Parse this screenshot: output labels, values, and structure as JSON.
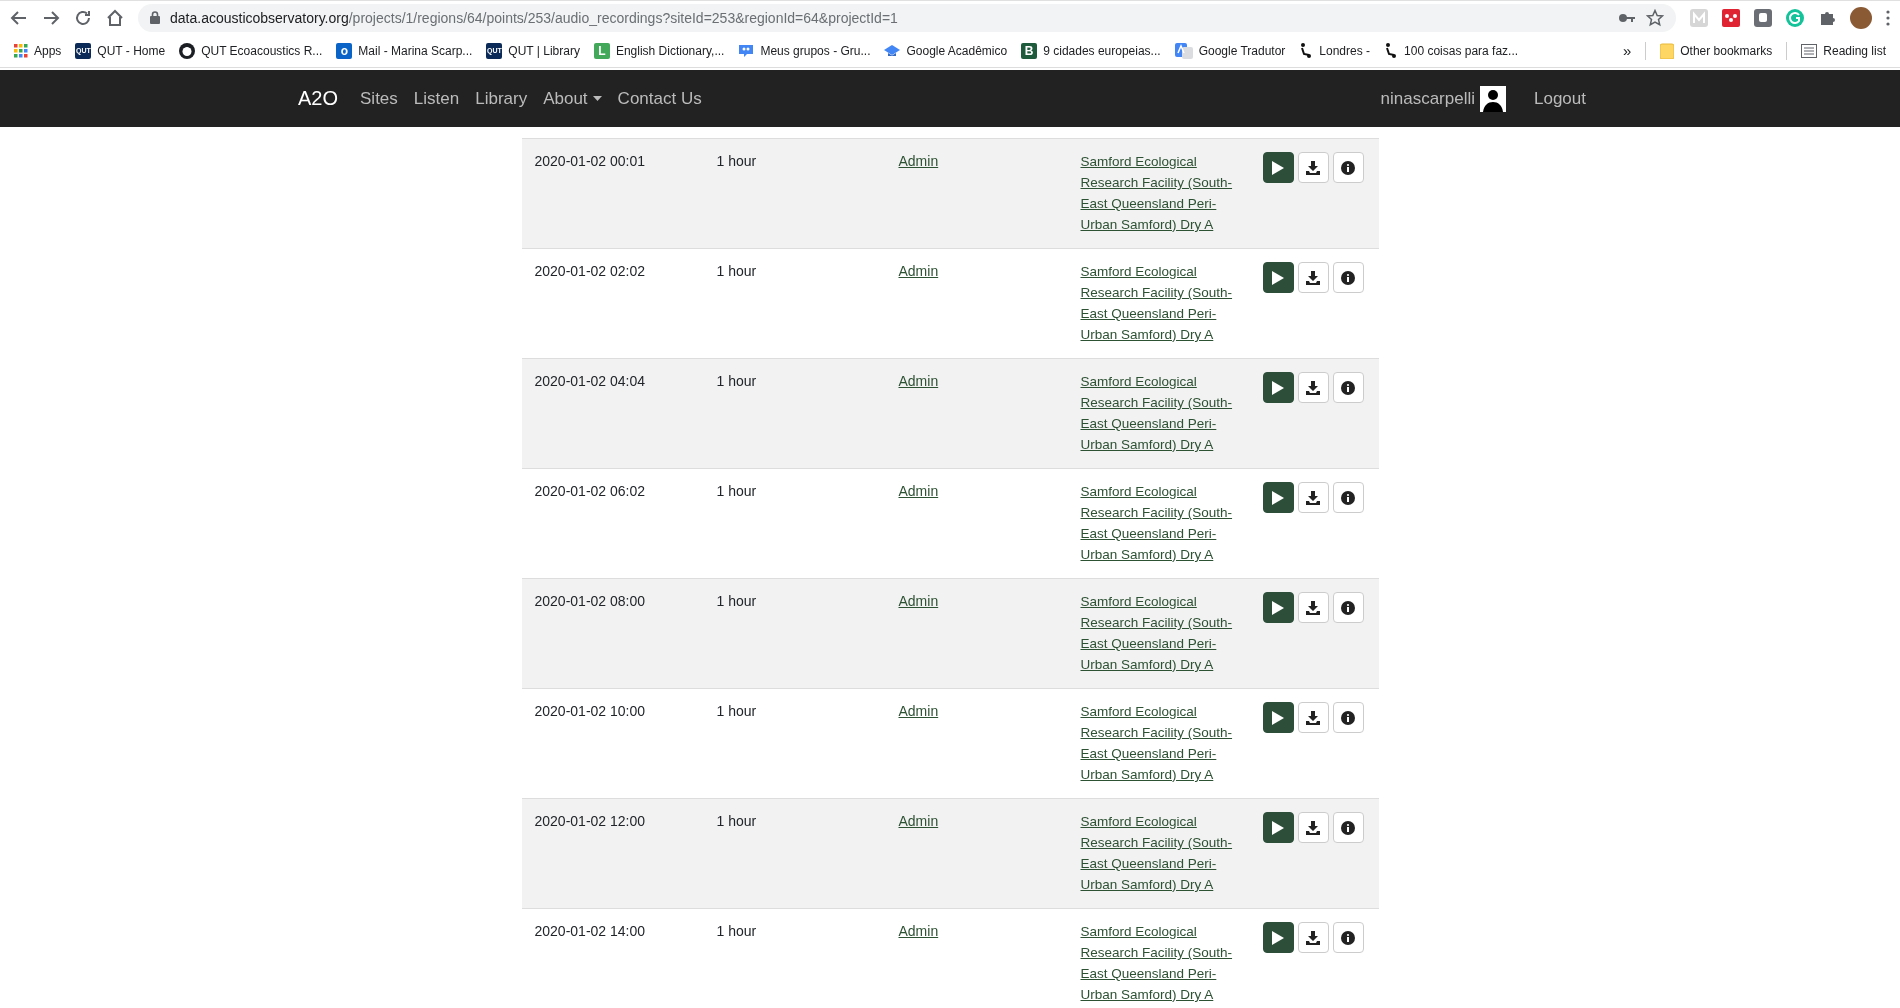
{
  "browser": {
    "url_host": "data.acousticobservatory.org",
    "url_rest": "/projects/1/regions/64/points/253/audio_recordings?siteId=253&regionId=64&projectId=1",
    "bookmarks": [
      {
        "label": "Apps",
        "icon": {
          "kind": "apps"
        }
      },
      {
        "label": "QUT - Home",
        "icon": {
          "kind": "badge",
          "badge": "QUT",
          "color": "#0b2a57"
        }
      },
      {
        "label": "QUT Ecoacoustics R...",
        "icon": {
          "kind": "github"
        }
      },
      {
        "label": "Mail - Marina Scarp...",
        "icon": {
          "kind": "badge",
          "badge": "o",
          "color": "#0a64c8"
        }
      },
      {
        "label": "QUT | Library",
        "icon": {
          "kind": "badge",
          "badge": "QUT",
          "color": "#0b2a57"
        }
      },
      {
        "label": "English Dictionary,...",
        "icon": {
          "kind": "badge",
          "badge": "L",
          "color": "#43a85a"
        }
      },
      {
        "label": "Meus grupos - Gru...",
        "icon": {
          "kind": "groups"
        }
      },
      {
        "label": "Google Acadêmico",
        "icon": {
          "kind": "cap"
        }
      },
      {
        "label": "9 cidades europeias...",
        "icon": {
          "kind": "badge",
          "badge": "B",
          "color": "#1e5b3c"
        }
      },
      {
        "label": "Google Tradutor",
        "icon": {
          "kind": "translate"
        }
      },
      {
        "label": "Londres -",
        "icon": {
          "kind": "walker"
        }
      },
      {
        "label": "100 coisas para faz...",
        "icon": {
          "kind": "walker"
        }
      }
    ],
    "overflow": "»",
    "other_bookmarks": "Other bookmarks",
    "reading_list": "Reading list"
  },
  "navbar": {
    "brand": "A2O",
    "links": [
      {
        "label": "Sites",
        "kind": "link"
      },
      {
        "label": "Listen",
        "kind": "link"
      },
      {
        "label": "Library",
        "kind": "link"
      },
      {
        "label": "About",
        "kind": "dropdown"
      },
      {
        "label": "Contact Us",
        "kind": "link"
      }
    ],
    "user": "ninascarpelli",
    "logout": "Logout"
  },
  "recordings": [
    {
      "date": "2020-01-02 00:01",
      "duration": "1 hour",
      "uploader": "Admin",
      "site": "Samford Ecological Research Facility (South-East Queensland Peri-Urban Samford) Dry A"
    },
    {
      "date": "2020-01-02 02:02",
      "duration": "1 hour",
      "uploader": "Admin",
      "site": "Samford Ecological Research Facility (South-East Queensland Peri-Urban Samford) Dry A"
    },
    {
      "date": "2020-01-02 04:04",
      "duration": "1 hour",
      "uploader": "Admin",
      "site": "Samford Ecological Research Facility (South-East Queensland Peri-Urban Samford) Dry A"
    },
    {
      "date": "2020-01-02 06:02",
      "duration": "1 hour",
      "uploader": "Admin",
      "site": "Samford Ecological Research Facility (South-East Queensland Peri-Urban Samford) Dry A"
    },
    {
      "date": "2020-01-02 08:00",
      "duration": "1 hour",
      "uploader": "Admin",
      "site": "Samford Ecological Research Facility (South-East Queensland Peri-Urban Samford) Dry A"
    },
    {
      "date": "2020-01-02 10:00",
      "duration": "1 hour",
      "uploader": "Admin",
      "site": "Samford Ecological Research Facility (South-East Queensland Peri-Urban Samford) Dry A"
    },
    {
      "date": "2020-01-02 12:00",
      "duration": "1 hour",
      "uploader": "Admin",
      "site": "Samford Ecological Research Facility (South-East Queensland Peri-Urban Samford) Dry A"
    },
    {
      "date": "2020-01-02 14:00",
      "duration": "1 hour",
      "uploader": "Admin",
      "site": "Samford Ecological Research Facility (South-East Queensland Peri-Urban Samford) Dry A"
    }
  ]
}
